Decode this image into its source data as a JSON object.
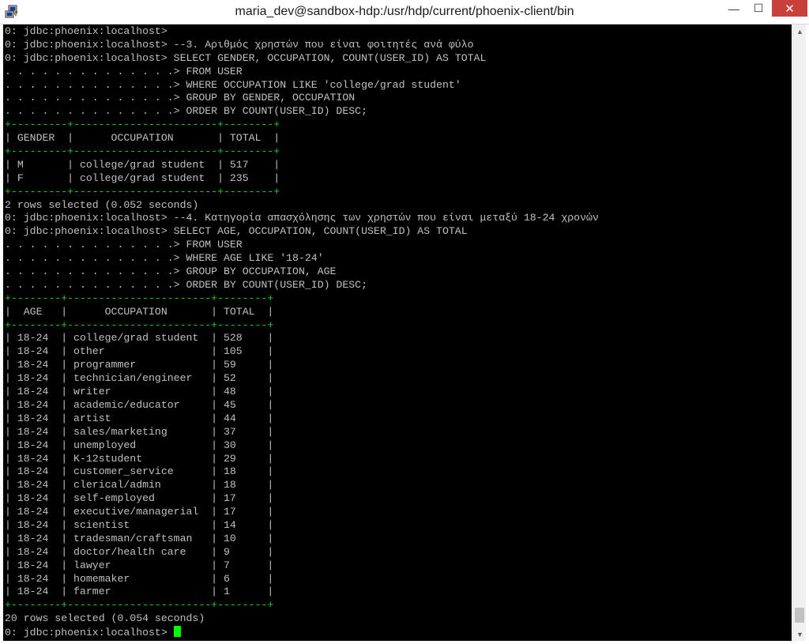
{
  "window": {
    "title": "maria_dev@sandbox-hdp:/usr/hdp/current/phoenix-client/bin",
    "icon": "putty-icon",
    "controls": {
      "minimize": "—",
      "maximize": "☐",
      "close": "✕"
    }
  },
  "terminal": {
    "lines": [
      {
        "text": "0: jdbc:phoenix:localhost>",
        "style": "normal"
      },
      {
        "text": "0: jdbc:phoenix:localhost> --3. Αριθμός χρηστών που είναι φοιτητές ανά φύλο",
        "style": "normal"
      },
      {
        "text": "0: jdbc:phoenix:localhost> SELECT GENDER, OCCUPATION, COUNT(USER_ID) AS TOTAL",
        "style": "normal"
      },
      {
        "text": ". . . . . . . . . . . . . .> FROM USER",
        "style": "normal"
      },
      {
        "text": ". . . . . . . . . . . . . .> WHERE OCCUPATION LIKE 'college/grad student'",
        "style": "normal"
      },
      {
        "text": ". . . . . . . . . . . . . .> GROUP BY GENDER, OCCUPATION",
        "style": "normal"
      },
      {
        "text": ". . . . . . . . . . . . . .> ORDER BY COUNT(USER_ID) DESC;",
        "style": "normal"
      },
      {
        "text": "+---------+-----------------------+--------+",
        "style": "green"
      },
      {
        "text": "| GENDER  |      OCCUPATION       | TOTAL  |",
        "style": "normal"
      },
      {
        "text": "+---------+-----------------------+--------+",
        "style": "green"
      },
      {
        "text": "| M       | college/grad student  | 517    |",
        "style": "normal"
      },
      {
        "text": "| F       | college/grad student  | 235    |",
        "style": "normal"
      },
      {
        "text": "+---------+-----------------------+--------+",
        "style": "green"
      },
      {
        "text": "2 rows selected (0.052 seconds)",
        "style": "normal"
      },
      {
        "text": "0: jdbc:phoenix:localhost> --4. Κατηγορία απασχόλησης των χρηστών που είναι μεταξύ 18-24 χρονών",
        "style": "normal"
      },
      {
        "text": "0: jdbc:phoenix:localhost> SELECT AGE, OCCUPATION, COUNT(USER_ID) AS TOTAL",
        "style": "normal"
      },
      {
        "text": ". . . . . . . . . . . . . .> FROM USER",
        "style": "normal"
      },
      {
        "text": ". . . . . . . . . . . . . .> WHERE AGE LIKE '18-24'",
        "style": "normal"
      },
      {
        "text": ". . . . . . . . . . . . . .> GROUP BY OCCUPATION, AGE",
        "style": "normal"
      },
      {
        "text": ". . . . . . . . . . . . . .> ORDER BY COUNT(USER_ID) DESC;",
        "style": "normal"
      },
      {
        "text": "+--------+-----------------------+--------+",
        "style": "green"
      },
      {
        "text": "|  AGE   |      OCCUPATION       | TOTAL  |",
        "style": "normal"
      },
      {
        "text": "+--------+-----------------------+--------+",
        "style": "green"
      },
      {
        "text": "| 18-24  | college/grad student  | 528    |",
        "style": "normal"
      },
      {
        "text": "| 18-24  | other                 | 105    |",
        "style": "normal"
      },
      {
        "text": "| 18-24  | programmer            | 59     |",
        "style": "normal"
      },
      {
        "text": "| 18-24  | technician/engineer   | 52     |",
        "style": "normal"
      },
      {
        "text": "| 18-24  | writer                | 48     |",
        "style": "normal"
      },
      {
        "text": "| 18-24  | academic/educator     | 45     |",
        "style": "normal"
      },
      {
        "text": "| 18-24  | artist                | 44     |",
        "style": "normal"
      },
      {
        "text": "| 18-24  | sales/marketing       | 37     |",
        "style": "normal"
      },
      {
        "text": "| 18-24  | unemployed            | 30     |",
        "style": "normal"
      },
      {
        "text": "| 18-24  | K-12student           | 29     |",
        "style": "normal"
      },
      {
        "text": "| 18-24  | customer_service      | 18     |",
        "style": "normal"
      },
      {
        "text": "| 18-24  | clerical/admin        | 18     |",
        "style": "normal"
      },
      {
        "text": "| 18-24  | self-employed         | 17     |",
        "style": "normal"
      },
      {
        "text": "| 18-24  | executive/managerial  | 17     |",
        "style": "normal"
      },
      {
        "text": "| 18-24  | scientist             | 14     |",
        "style": "normal"
      },
      {
        "text": "| 18-24  | tradesman/craftsman   | 10     |",
        "style": "normal"
      },
      {
        "text": "| 18-24  | doctor/health care    | 9      |",
        "style": "normal"
      },
      {
        "text": "| 18-24  | lawyer                | 7      |",
        "style": "normal"
      },
      {
        "text": "| 18-24  | homemaker             | 6      |",
        "style": "normal"
      },
      {
        "text": "| 18-24  | farmer                | 1      |",
        "style": "normal"
      },
      {
        "text": "+--------+-----------------------+--------+",
        "style": "green"
      },
      {
        "text": "20 rows selected (0.054 seconds)",
        "style": "normal"
      }
    ],
    "prompt": "0: jdbc:phoenix:localhost> ",
    "colors": {
      "background": "#000000",
      "text": "#c0c0c0",
      "border": "#19d219",
      "cursor": "#00ff00"
    }
  },
  "scrollbar": {
    "up_icon": "chevron-up-icon",
    "down_icon": "chevron-down-icon",
    "position": 0.97
  }
}
